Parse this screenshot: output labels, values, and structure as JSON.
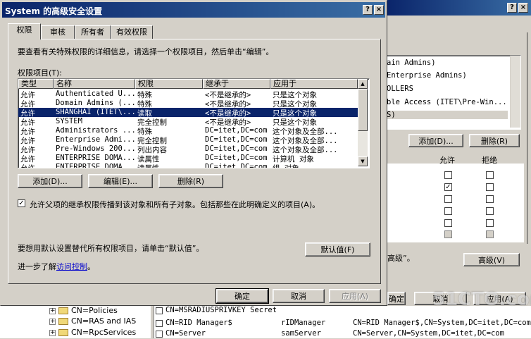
{
  "background_window": {
    "list_items": [
      "ain Admins)",
      "Enterprise Admins)",
      "OLLERS",
      "ble Access (ITET\\Pre-Win...",
      "S)"
    ],
    "add_button": "添加(D)...",
    "remove_button": "删除(R)",
    "col_allow": "允许",
    "col_deny": "拒绝",
    "perm_rows": [
      {
        "allow": "",
        "deny": ""
      },
      {
        "allow": "✓",
        "deny": ""
      },
      {
        "allow": "",
        "deny": ""
      },
      {
        "allow": "",
        "deny": ""
      },
      {
        "allow": "",
        "deny": ""
      },
      {
        "allow": "",
        "deny": ""
      }
    ],
    "advanced_hint": "高级”。",
    "advanced_button": "高级(V)",
    "ok_button": "确定",
    "cancel_button": "取消",
    "apply_button": "应用(A)"
  },
  "bottom_pane": {
    "tree": [
      "CN=Policies",
      "CN=RAS and IAS",
      "CN=RpcServices"
    ],
    "rows": [
      {
        "name": "CN=MSRADIUSPRIVKEY Secret",
        "class": "",
        "dn": ""
      },
      {
        "name": "CN=RID Manager$",
        "class": "rIDManager",
        "dn": "CN=RID Manager$,CN=System,DC=itet,DC=com"
      },
      {
        "name": "CN=Server",
        "class": "samServer",
        "dn": "CN=Server,CN=System,DC=itet,DC=com"
      }
    ]
  },
  "dialog": {
    "title": "System 的高级安全设置",
    "help_btn": "?",
    "close_btn": "×",
    "tabs": [
      "权限",
      "审核",
      "所有者",
      "有效权限"
    ],
    "description": "要查看有关特殊权限的详细信息，请选择一个权限项目，然后单击“编辑”。",
    "list_label": "权限项目(T):",
    "columns": [
      "类型",
      "名称",
      "权限",
      "继承于",
      "应用于"
    ],
    "rows": [
      {
        "type": "允许",
        "name": "Authenticated U...",
        "perm": "特殊",
        "inherit": "<不是继承的>",
        "apply": "只是这个对象"
      },
      {
        "type": "允许",
        "name": "Domain Admins (...",
        "perm": "特殊",
        "inherit": "<不是继承的>",
        "apply": "只是这个对象"
      },
      {
        "type": "允许",
        "name": "SHANGHAI (ITET\\...",
        "perm": "读取",
        "inherit": "<不是继承的>",
        "apply": "只是这个对象"
      },
      {
        "type": "允许",
        "name": "SYSTEM",
        "perm": "完全控制",
        "inherit": "<不是继承的>",
        "apply": "只是这个对象"
      },
      {
        "type": "允许",
        "name": "Administrators ...",
        "perm": "特殊",
        "inherit": "DC=itet,DC=com",
        "apply": "这个对象及全部..."
      },
      {
        "type": "允许",
        "name": "Enterprise Admi...",
        "perm": "完全控制",
        "inherit": "DC=itet,DC=com",
        "apply": "这个对象及全部..."
      },
      {
        "type": "允许",
        "name": "Pre-Windows 200...",
        "perm": "列出内容",
        "inherit": "DC=itet,DC=com",
        "apply": "这个对象及全部..."
      },
      {
        "type": "允许",
        "name": "ENTERPRISE DOMA...",
        "perm": "读属性",
        "inherit": "DC=itet,DC=com",
        "apply": "计算机 对象"
      },
      {
        "type": "允许",
        "name": "ENTERPRISE DOMA...",
        "perm": "读属性",
        "inherit": "DC=itet,DC=com",
        "apply": "组 对象"
      }
    ],
    "selected_index": 2,
    "add_button": "添加(D)...",
    "edit_button": "编辑(E)...",
    "remove_button": "删除(R)",
    "inherit_checkbox_label": "允许父项的继承权限传播到该对象和所有子对象。包括那些在此明确定义的项目(A)。",
    "inherit_checked": true,
    "default_text": "要想用默认设置替代所有权限项目，请单击“默认值”。",
    "default_button": "默认值(F)",
    "learn_more_prefix": "进一步了解",
    "learn_more_link": "访问控制",
    "learn_more_suffix": "。",
    "ok_button": "确定",
    "cancel_button": "取消",
    "apply_button": "应用(A)"
  },
  "watermark": "51CTO.com"
}
